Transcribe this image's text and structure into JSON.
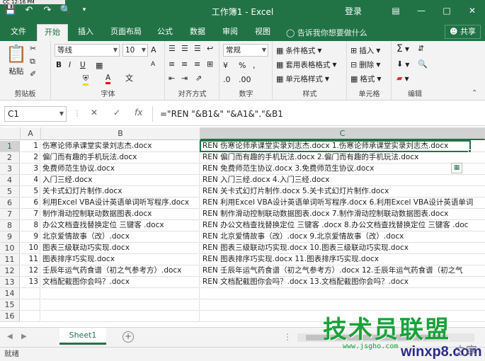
{
  "titlebar": {
    "time": "CC 12:16 PM",
    "title": "工作簿1 - Excel",
    "login": "登录",
    "quick_access": [
      "save-icon",
      "undo-icon",
      "redo-icon",
      "print-preview-icon"
    ],
    "window_controls": [
      "ribbon-options-icon",
      "minimize-icon",
      "maximize-icon",
      "close-icon"
    ]
  },
  "tabs": {
    "file": "文件",
    "home": "开始",
    "insert": "插入",
    "layout": "页面布局",
    "formulas": "公式",
    "data": "数据",
    "review": "审阅",
    "view": "视图",
    "tellme": "告诉我你想要做什么",
    "share": "共享"
  },
  "ribbon": {
    "clipboard": {
      "paste": "粘贴",
      "label": "剪贴板"
    },
    "font": {
      "name": "等线",
      "size": "10",
      "bold": "B",
      "italic": "I",
      "underline": "U",
      "grow": "A",
      "shrink": "A",
      "color": "A",
      "label": "字体"
    },
    "alignment": {
      "label": "对齐方式"
    },
    "number": {
      "format": "常规",
      "label": "数字"
    },
    "styles": {
      "conditional": "条件格式",
      "table": "套用表格格式",
      "cell": "单元格样式",
      "label": "样式"
    },
    "cells": {
      "insert": "插入",
      "delete": "删除",
      "format": "格式",
      "label": "单元格"
    },
    "editing": {
      "label": "编辑"
    },
    "accent_color": "#217346"
  },
  "formula_bar": {
    "namebox": "C1",
    "formula": "=\"REN \"&B1&\" \"&A1&\".\"&B1",
    "fx": "fx"
  },
  "sheet": {
    "columns": [
      "A",
      "B",
      "C"
    ],
    "selected_column": "C",
    "selected_row": "1",
    "rows": [
      {
        "row": "1",
        "a": "1",
        "b": "伤寒论师承课堂实录刘志杰.docx",
        "c": "REN 伤寒论师承课堂实录刘志杰.docx 1.伤寒论师承课堂实录刘志杰.docx"
      },
      {
        "row": "2",
        "a": "2",
        "b": "偏门而有趣的手机玩法.docx",
        "c": "REN 偏门而有趣的手机玩法.docx 2.偏门而有趣的手机玩法.docx"
      },
      {
        "row": "3",
        "a": "3",
        "b": "免费师范生协议.docx",
        "c": "REN 免费师范生协议.docx 3.免费师范生协议.docx"
      },
      {
        "row": "4",
        "a": "4",
        "b": "入门三经.docx",
        "c": "REN 入门三经.docx 4.入门三经.docx"
      },
      {
        "row": "5",
        "a": "5",
        "b": "关卡式幻灯片制作.docx",
        "c": "REN 关卡式幻灯片制作.docx 5.关卡式幻灯片制作.docx"
      },
      {
        "row": "6",
        "a": "6",
        "b": "利用Excel VBA设计英语单词听写程序.docx",
        "c": "REN 利用Excel VBA设计英语单词听写程序.docx 6.利用Excel VBA设计英语单词"
      },
      {
        "row": "7",
        "a": "7",
        "b": "制作滑动控制联动数据图表.docx",
        "c": "REN 制作滑动控制联动数据图表.docx 7.制作滑动控制联动数据图表.docx"
      },
      {
        "row": "8",
        "a": "8",
        "b": "办公文档查找替换定位 三键客 .docx",
        "c": "REN 办公文档查找替换定位 三键客 .docx 8.办公文档查找替换定位 三键客 .doc"
      },
      {
        "row": "9",
        "a": "9",
        "b": "北京爱情故事（改）.docx",
        "c": "REN 北京爱情故事（改）.docx 9.北京爱情故事（改）.docx"
      },
      {
        "row": "10",
        "a": "10",
        "b": "图表三级联动巧实现.docx",
        "c": "REN 图表三级联动巧实现.docx 10.图表三级联动巧实现.docx"
      },
      {
        "row": "11",
        "a": "11",
        "b": "图表排序巧实现.docx",
        "c": "REN 图表排序巧实现.docx 11.图表排序巧实现.docx"
      },
      {
        "row": "12",
        "a": "12",
        "b": "壬辰年运气药食谱（初之气参考方）.docx",
        "c": "REN 壬辰年运气药食谱（初之气参考方）.docx 12.壬辰年运气药食谱（初之气"
      },
      {
        "row": "13",
        "a": "13",
        "b": "文档配截图你会吗？.docx",
        "c": "REN 文档配截图你会吗？.docx 13.文档配截图你会吗？.docx"
      },
      {
        "row": "14",
        "a": "",
        "b": "",
        "c": ""
      },
      {
        "row": "15",
        "a": "",
        "b": "",
        "c": ""
      },
      {
        "row": "16",
        "a": "",
        "b": "",
        "c": ""
      }
    ],
    "sheet_tab": "Sheet1"
  },
  "status": {
    "text": "就绪"
  },
  "watermark": {
    "line1": "技术员联盟",
    "line2": "www.jsgho.com",
    "line3": "winxp8.com",
    "line4": "之家"
  }
}
